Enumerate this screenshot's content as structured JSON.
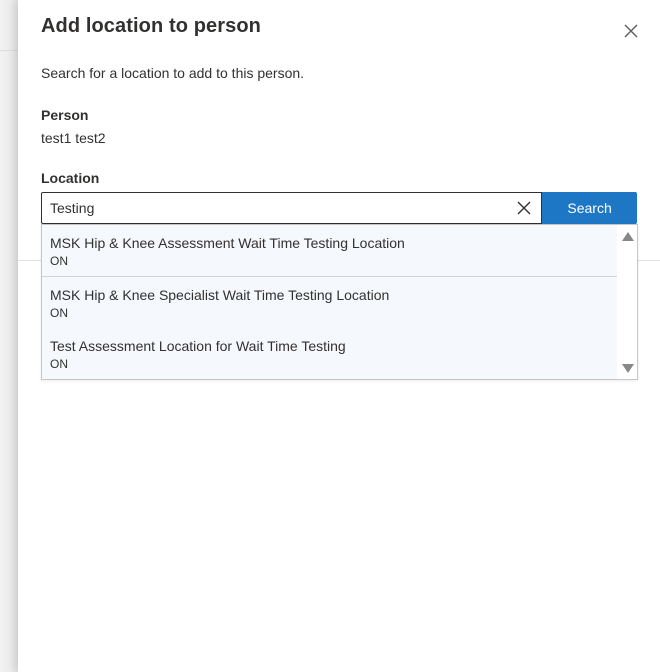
{
  "dialog": {
    "title": "Add location to person",
    "subtitle": "Search for a location to add to this person."
  },
  "person": {
    "label": "Person",
    "value": "test1 test2"
  },
  "location": {
    "label": "Location",
    "input_value": "Testing",
    "search_label": "Search"
  },
  "results": [
    {
      "name": "MSK Hip & Knee Assessment Wait Time Testing Location",
      "region": "ON"
    },
    {
      "name": "MSK Hip & Knee Specialist Wait Time Testing Location",
      "region": "ON"
    },
    {
      "name": "Test Assessment Location for Wait Time Testing",
      "region": "ON"
    }
  ],
  "icons": {
    "close": "close-icon",
    "clear": "clear-icon",
    "scroll_up": "triangle-up-icon",
    "scroll_down": "triangle-down-icon"
  },
  "colors": {
    "accent": "#1d77c4",
    "item_bg": "#f5f8fd",
    "text": "#323130"
  }
}
